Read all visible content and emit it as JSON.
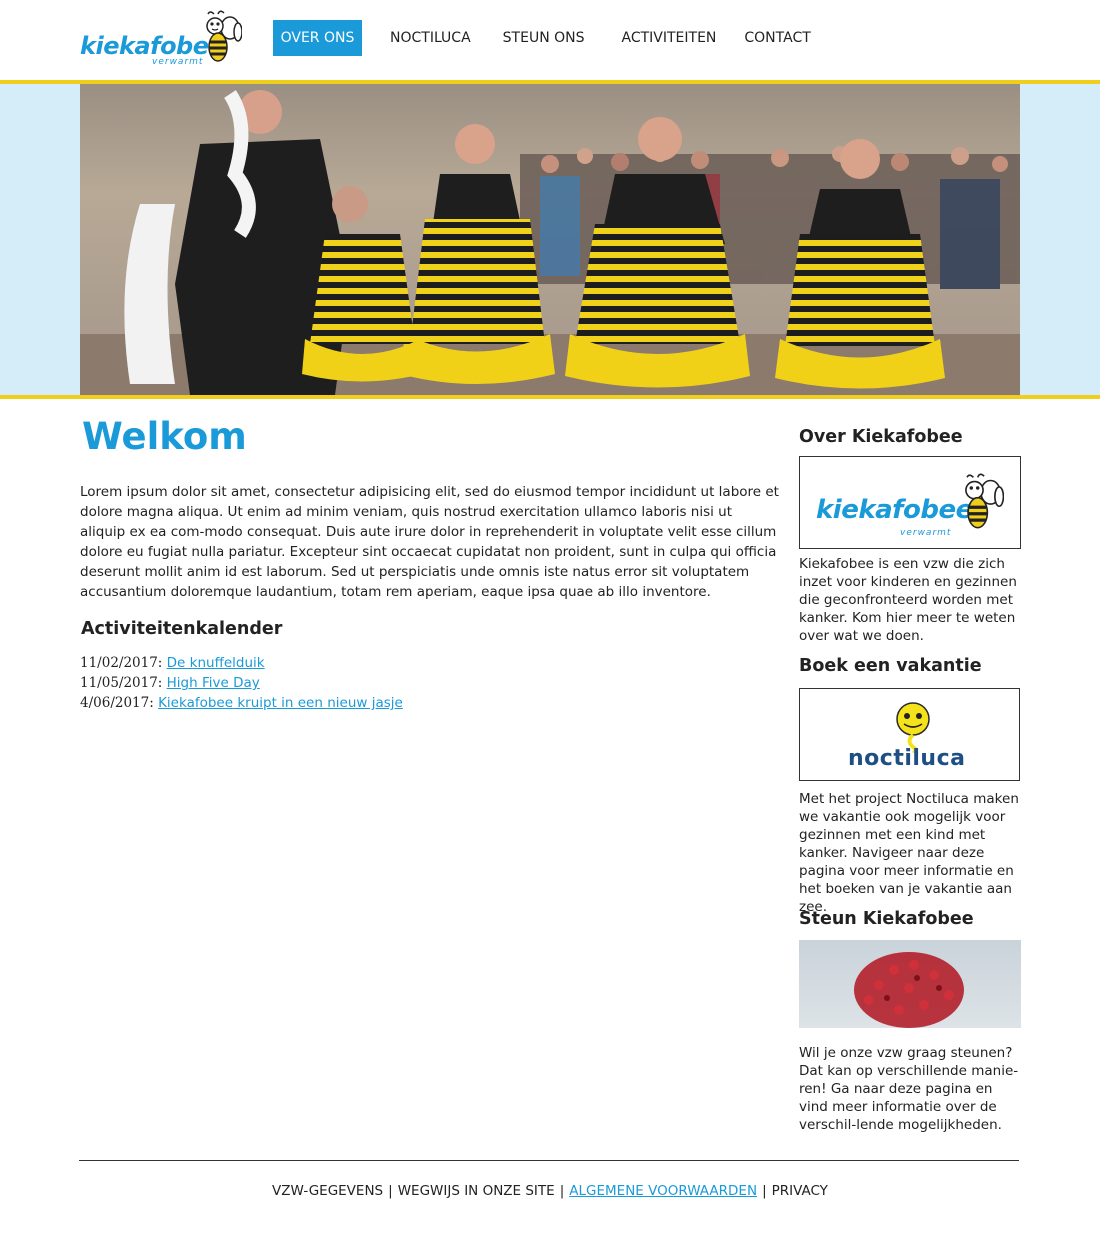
{
  "header": {
    "logo": {
      "name": "kiekafobee",
      "tagline": "verwarmt"
    },
    "nav": [
      {
        "label": "OVER ONS",
        "active": true
      },
      {
        "label": "NOCTILUCA",
        "active": false
      },
      {
        "label": "STEUN ONS",
        "active": false
      },
      {
        "label": "ACTIVITEITEN",
        "active": false
      },
      {
        "label": "CONTACT",
        "active": false
      }
    ]
  },
  "colors": {
    "accent": "#1a9ad8",
    "yellow": "#f0cf1c",
    "hero_band": "#d5edf8"
  },
  "main": {
    "title": "Welkom",
    "intro": "Lorem ipsum dolor sit amet, consectetur adipisicing elit, sed do eiusmod tempor incididunt ut labore et dolore magna aliqua. Ut enim ad minim veniam, quis nostrud exercitation ullamco laboris nisi ut aliquip ex ea com-modo consequat. Duis aute irure dolor in reprehenderit in voluptate velit esse cillum dolore eu fugiat nulla pariatur. Excepteur sint occaecat cupidatat non proident, sunt in culpa qui officia deserunt mollit anim id est laborum. Sed ut perspiciatis unde omnis iste natus error sit voluptatem accusantium doloremque laudantium, totam rem aperiam, eaque ipsa quae ab illo inventore.",
    "calendar_title": "Activiteitenkalender",
    "calendar": [
      {
        "date": "11/02/2017:",
        "label": "De knuffelduik"
      },
      {
        "date": "11/05/2017:",
        "label": "High Five Day"
      },
      {
        "date": "4/06/2017:",
        "label": "Kiekafobee kruipt in een nieuw jasje"
      }
    ]
  },
  "sidebar": {
    "about": {
      "title": "Over Kiekafobee",
      "logo_name": "kiekafobee",
      "logo_tagline": "verwarmt",
      "text": "Kiekafobee is een vzw die zich inzet voor kinderen en gezinnen die geconfronteerd worden met kanker. Kom hier meer te weten over wat we doen."
    },
    "vacation": {
      "title": "Boek een vakantie",
      "logo_name": "noctiluca",
      "text": "Met het project Noctiluca maken we vakantie ook mogelijk voor gezinnen met een kind met kanker. Navigeer naar deze pagina voor meer informatie en het boeken van je vakantie aan zee."
    },
    "support": {
      "title": "Steun Kiekafobee",
      "text": "Wil je onze vzw graag steunen? Dat kan op verschillende manie-ren! Ga naar deze pagina en vind meer informatie over de verschil-lende mogelijkheden."
    }
  },
  "footer": {
    "links": [
      {
        "label": "VZW-GEGEVENS",
        "link": false
      },
      {
        "label": "WEGWIJS IN ONZE SITE",
        "link": false
      },
      {
        "label": "ALGEMENE VOORWAARDEN",
        "link": true
      },
      {
        "label": "PRIVACY",
        "link": false
      }
    ],
    "separator": "|"
  }
}
